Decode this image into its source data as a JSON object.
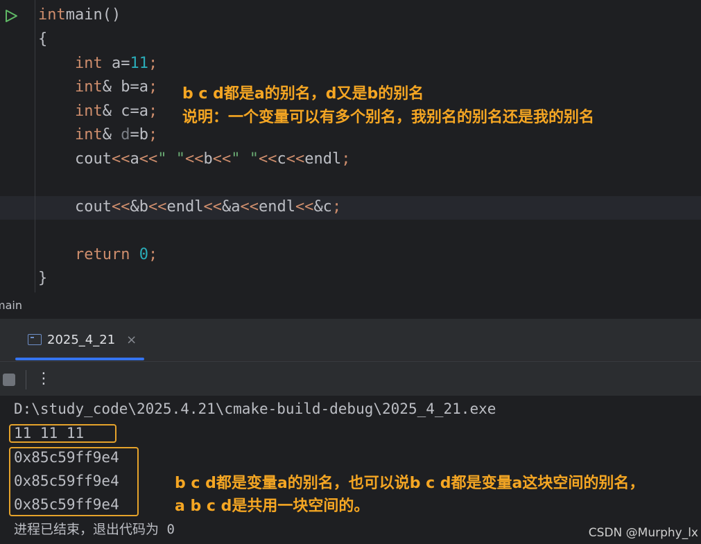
{
  "editor": {
    "lines": [
      {
        "parts": [
          [
            "kw",
            "int"
          ],
          [
            "",
            "main"
          ],
          [
            "",
            "()"
          ]
        ]
      },
      {
        "parts": [
          [
            "",
            "{"
          ]
        ]
      },
      {
        "parts": [
          [
            "",
            "    "
          ],
          [
            "kw",
            "int"
          ],
          [
            "",
            " a="
          ],
          [
            "num",
            "11"
          ],
          [
            "kw",
            ";"
          ]
        ]
      },
      {
        "parts": [
          [
            "",
            "    "
          ],
          [
            "kw",
            "int"
          ],
          [
            "",
            "& b=a"
          ],
          [
            "kw",
            ";"
          ]
        ]
      },
      {
        "parts": [
          [
            "",
            "    "
          ],
          [
            "kw",
            "int"
          ],
          [
            "",
            "& c=a"
          ],
          [
            "kw",
            ";"
          ]
        ]
      },
      {
        "parts": [
          [
            "",
            "    "
          ],
          [
            "kw",
            "int"
          ],
          [
            "",
            "& "
          ],
          [
            "dim",
            "d"
          ],
          [
            "",
            "=b"
          ],
          [
            "kw",
            ";"
          ]
        ]
      },
      {
        "parts": [
          [
            "",
            "    cout"
          ],
          [
            "kw",
            "<<"
          ],
          [
            "",
            "a"
          ],
          [
            "kw",
            "<<"
          ],
          [
            "str",
            "\" \""
          ],
          [
            "kw",
            "<<"
          ],
          [
            "",
            "b"
          ],
          [
            "kw",
            "<<"
          ],
          [
            "str",
            "\" \""
          ],
          [
            "kw",
            "<<"
          ],
          [
            "",
            "c"
          ],
          [
            "kw",
            "<<"
          ],
          [
            "",
            "endl"
          ],
          [
            "kw",
            ";"
          ]
        ]
      },
      {
        "parts": [
          [
            "",
            ""
          ]
        ]
      },
      {
        "parts": [
          [
            "",
            "    cout"
          ],
          [
            "kw",
            "<<"
          ],
          [
            "",
            "&b"
          ],
          [
            "kw",
            "<<"
          ],
          [
            "",
            "endl"
          ],
          [
            "kw",
            "<<"
          ],
          [
            "",
            "&a"
          ],
          [
            "kw",
            "<<"
          ],
          [
            "",
            "endl"
          ],
          [
            "kw",
            "<<"
          ],
          [
            "",
            "&c"
          ],
          [
            "kw",
            ";"
          ]
        ]
      },
      {
        "parts": [
          [
            "",
            ""
          ]
        ]
      },
      {
        "parts": [
          [
            "",
            "    "
          ],
          [
            "kw",
            "return "
          ],
          [
            "num",
            "0"
          ],
          [
            "kw",
            ";"
          ]
        ]
      },
      {
        "parts": [
          [
            "",
            "}"
          ]
        ]
      }
    ],
    "annotation_1": "b c d都是a的别名，d又是b的别名",
    "annotation_2": "说明：一个变量可以有多个别名，我别名的别名还是我的别名"
  },
  "breadcrumb": {
    "label": "main"
  },
  "run_window": {
    "tab_title": "2025_4_21",
    "tab_close": "×",
    "more_label": "⋮"
  },
  "console": {
    "path": "D:\\study_code\\2025.4.21\\cmake-build-debug\\2025_4_21.exe",
    "values_line": "11 11 11",
    "addresses": [
      "0x85c59ff9e4",
      "0x85c59ff9e4",
      "0x85c59ff9e4"
    ],
    "annotation_1": "b c d都是变量a的别名，也可以说b c d都是变量a这块空间的别名，",
    "annotation_2": "a b c d是共用一块空间的。",
    "exit_message": "进程已结束，退出代码为 0"
  },
  "watermark": "CSDN @Murphy_lx",
  "colors": {
    "keyword": "#cf8e6d",
    "number": "#2aacb8",
    "string": "#6aab73",
    "annotation": "#f5a623",
    "tab_underline": "#3574f0"
  }
}
